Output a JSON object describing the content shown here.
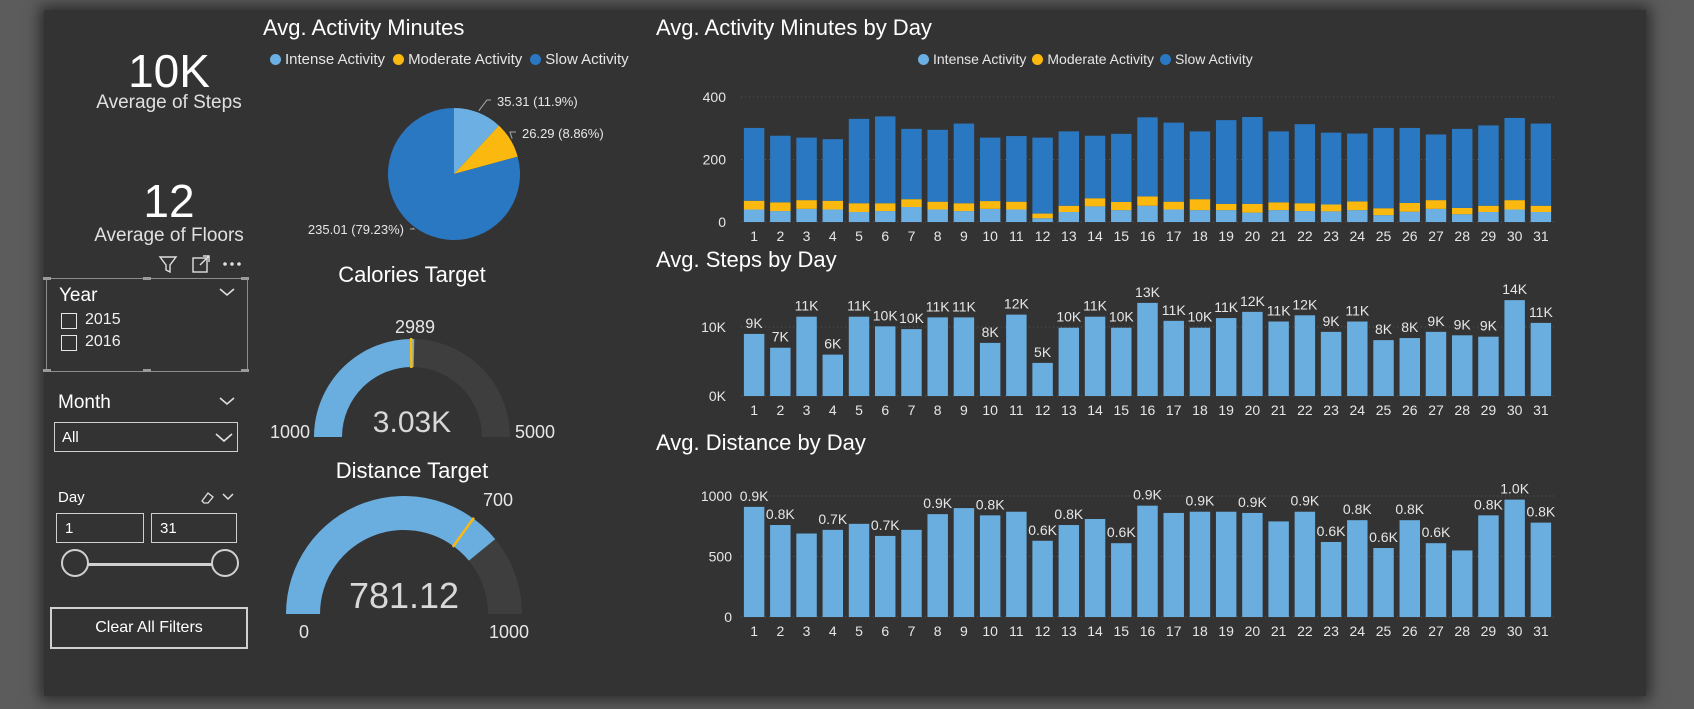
{
  "kpis": {
    "steps": {
      "value": "10K",
      "label": "Average of Steps"
    },
    "floors": {
      "value": "12",
      "label": "Average of Floors"
    }
  },
  "filters": {
    "year": {
      "title": "Year",
      "options": [
        "2015",
        "2016"
      ]
    },
    "month": {
      "title": "Month",
      "selected": "All"
    },
    "day": {
      "title": "Day",
      "from": "1",
      "to": "31"
    },
    "clear_label": "Clear All Filters"
  },
  "colors": {
    "intense": "#6cb0e3",
    "moderate": "#fbb90f",
    "slow": "#2b78c2",
    "bar": "#6aaee0",
    "gauge_track": "#3e3e3e",
    "target": "#fbb90f"
  },
  "activity_pie": {
    "title": "Avg. Activity Minutes",
    "legend": [
      "Intense Activity",
      "Moderate Activity",
      "Slow Activity"
    ],
    "labels": [
      "35.31 (11.9%)",
      "26.29 (8.86%)",
      "235.01 (79.23%)"
    ]
  },
  "calories_gauge": {
    "title": "Calories Target",
    "value_label": "3.03K",
    "target_label": "2989",
    "min_label": "1000",
    "max_label": "5000"
  },
  "distance_gauge": {
    "title": "Distance Target",
    "value_label": "781.12",
    "target_label": "700",
    "min_label": "0",
    "max_label": "1000"
  },
  "activity_by_day": {
    "title": "Avg. Activity Minutes by Day",
    "legend": [
      "Intense Activity",
      "Moderate Activity",
      "Slow Activity"
    ]
  },
  "steps_by_day": {
    "title": "Avg. Steps by Day"
  },
  "distance_by_day": {
    "title": "Avg. Distance by Day"
  },
  "chart_data": [
    {
      "type": "pie",
      "title": "Avg. Activity Minutes",
      "categories": [
        "Intense Activity",
        "Moderate Activity",
        "Slow Activity"
      ],
      "values": [
        35.31,
        26.29,
        235.01
      ],
      "data_labels": [
        "35.31 (11.9%)",
        "26.29 (8.86%)",
        "235.01 (79.23%)"
      ],
      "legend": "top"
    },
    {
      "type": "gauge",
      "title": "Calories Target",
      "value": 3030,
      "target": 2989,
      "min": 1000,
      "max": 5000,
      "value_label": "3.03K",
      "target_label": "2989",
      "min_label": "1000",
      "max_label": "5000"
    },
    {
      "type": "gauge",
      "title": "Distance Target",
      "value": 781.12,
      "target": 700,
      "min": 0,
      "max": 1000,
      "value_label": "781.12",
      "target_label": "700",
      "min_label": "0",
      "max_label": "1000"
    },
    {
      "type": "bar",
      "stacked": true,
      "title": "Avg. Activity Minutes by Day",
      "categories": [
        "1",
        "2",
        "3",
        "4",
        "5",
        "6",
        "7",
        "8",
        "9",
        "10",
        "11",
        "12",
        "13",
        "14",
        "15",
        "16",
        "17",
        "18",
        "19",
        "20",
        "21",
        "22",
        "23",
        "24",
        "25",
        "26",
        "27",
        "28",
        "29",
        "30",
        "31"
      ],
      "series": [
        {
          "name": "Intense Activity",
          "values": [
            40,
            35,
            42,
            40,
            32,
            35,
            48,
            40,
            35,
            42,
            40,
            12,
            32,
            50,
            38,
            52,
            40,
            38,
            38,
            30,
            38,
            35,
            34,
            38,
            22,
            33,
            42,
            25,
            32,
            40,
            32
          ]
        },
        {
          "name": "Moderate Activity",
          "values": [
            28,
            28,
            28,
            28,
            28,
            25,
            25,
            25,
            25,
            25,
            25,
            15,
            20,
            26,
            26,
            30,
            25,
            35,
            20,
            28,
            25,
            25,
            22,
            28,
            22,
            28,
            28,
            20,
            20,
            30,
            20
          ]
        },
        {
          "name": "Slow Activity",
          "values": [
            233,
            213,
            200,
            197,
            270,
            278,
            225,
            230,
            255,
            203,
            210,
            243,
            238,
            200,
            218,
            253,
            253,
            217,
            268,
            278,
            227,
            253,
            230,
            217,
            257,
            240,
            210,
            253,
            257,
            263,
            263
          ]
        }
      ],
      "yticks": [
        "0",
        "200",
        "400"
      ],
      "ylim": [
        0,
        400
      ],
      "grid": true,
      "legend": "top-center"
    },
    {
      "type": "bar",
      "title": "Avg. Steps by Day",
      "categories": [
        "1",
        "2",
        "3",
        "4",
        "5",
        "6",
        "7",
        "8",
        "9",
        "10",
        "11",
        "12",
        "13",
        "14",
        "15",
        "16",
        "17",
        "18",
        "19",
        "20",
        "21",
        "22",
        "23",
        "24",
        "25",
        "26",
        "27",
        "28",
        "29",
        "30",
        "31"
      ],
      "values": [
        9000,
        7000,
        11500,
        6000,
        11500,
        10100,
        9700,
        11400,
        11400,
        7700,
        11800,
        4800,
        9900,
        11500,
        9900,
        13500,
        10900,
        9900,
        11300,
        12200,
        10800,
        11700,
        9300,
        10800,
        8100,
        8400,
        9300,
        8800,
        8600,
        13900,
        10600
      ],
      "data_labels": [
        "9K",
        "7K",
        "11K",
        "6K",
        "11K",
        "10K",
        "10K",
        "11K",
        "11K",
        "8K",
        "12K",
        "5K",
        "10K",
        "11K",
        "10K",
        "13K",
        "11K",
        "10K",
        "11K",
        "12K",
        "11K",
        "12K",
        "9K",
        "11K",
        "8K",
        "8K",
        "9K",
        "9K",
        "9K",
        "14K",
        "11K"
      ],
      "yticks": [
        "0K",
        "10K"
      ],
      "ylim": [
        0,
        14500
      ],
      "grid": true
    },
    {
      "type": "bar",
      "title": "Avg. Distance by Day",
      "categories": [
        "1",
        "2",
        "3",
        "4",
        "5",
        "6",
        "7",
        "8",
        "9",
        "10",
        "11",
        "12",
        "13",
        "14",
        "15",
        "16",
        "17",
        "18",
        "19",
        "20",
        "21",
        "22",
        "23",
        "24",
        "25",
        "26",
        "27",
        "28",
        "29",
        "30",
        "31"
      ],
      "values": [
        910,
        760,
        690,
        720,
        770,
        670,
        720,
        850,
        900,
        840,
        870,
        630,
        760,
        810,
        610,
        920,
        860,
        870,
        870,
        860,
        790,
        870,
        620,
        800,
        570,
        800,
        610,
        550,
        840,
        970,
        780
      ],
      "data_labels": [
        "0.9K",
        "0.8K",
        "",
        "0.7K",
        "",
        "0.7K",
        "",
        "0.9K",
        "",
        "0.8K",
        "",
        "0.6K",
        "0.8K",
        "",
        "0.6K",
        "0.9K",
        "",
        "0.9K",
        "",
        "0.9K",
        "",
        "0.9K",
        "0.6K",
        "0.8K",
        "0.6K",
        "0.8K",
        "0.6K",
        "",
        "0.8K",
        "1.0K",
        "0.8K"
      ],
      "yticks": [
        "0",
        "500",
        "1000"
      ],
      "ylim": [
        0,
        1000
      ],
      "grid": true
    }
  ]
}
